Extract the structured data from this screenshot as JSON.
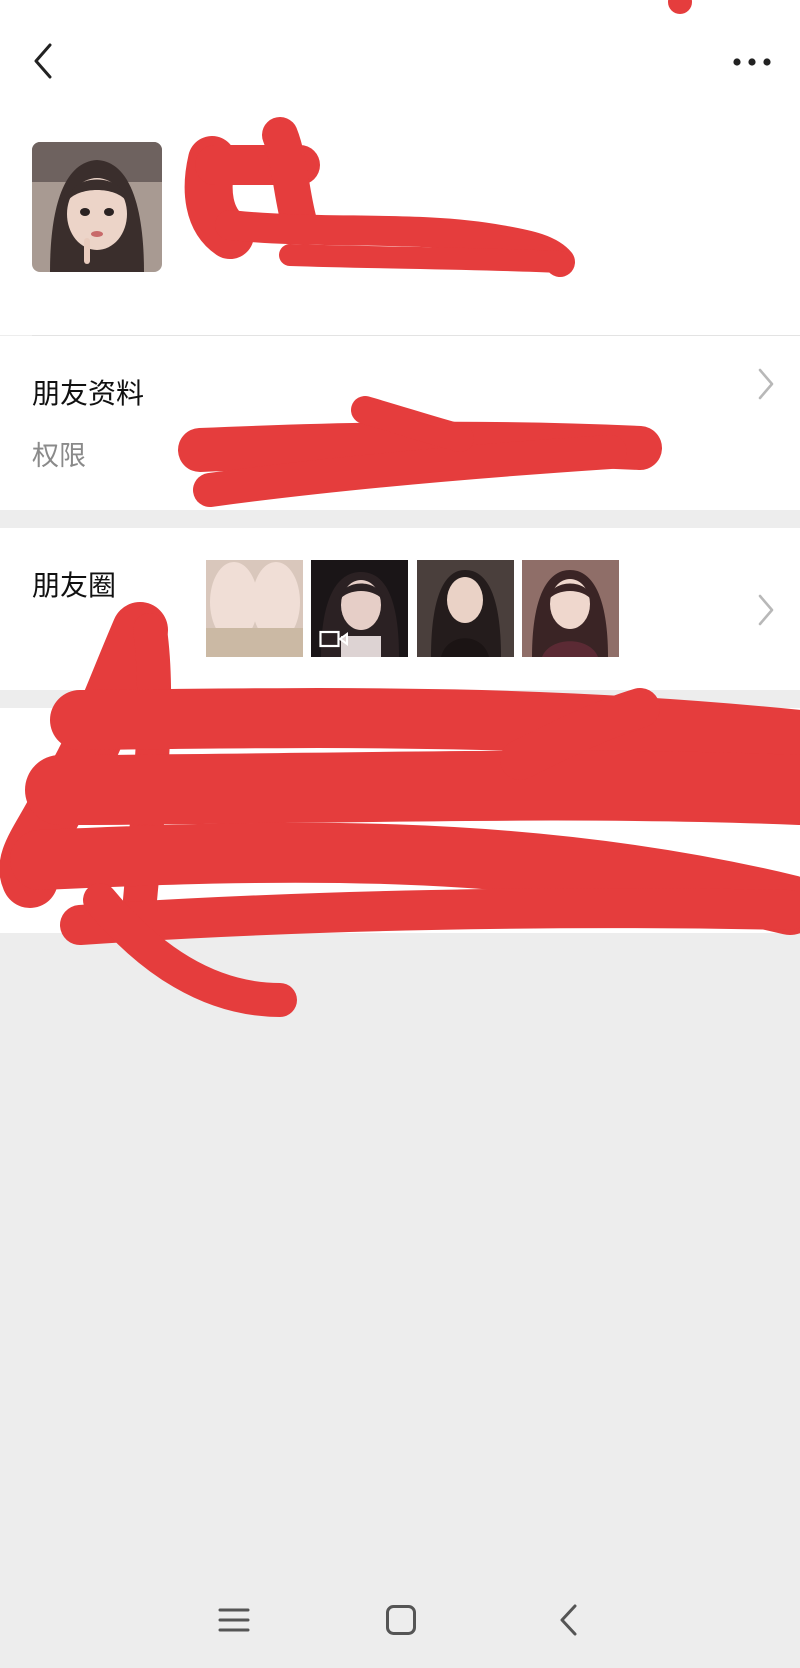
{
  "header": {
    "back_icon": "chevron-left-icon",
    "more_icon": "more-horizontal-icon"
  },
  "profile": {
    "avatar_icon": "avatar-photo",
    "name_redacted": true
  },
  "friend_info": {
    "title": "朋友资料",
    "permissions_label": "权限"
  },
  "moments": {
    "title": "朋友圈",
    "thumbnails": [
      {
        "kind": "photo"
      },
      {
        "kind": "video",
        "badge_icon": "video-icon"
      },
      {
        "kind": "photo"
      },
      {
        "kind": "photo"
      }
    ]
  },
  "system_nav": {
    "menu_icon": "menu-icon",
    "home_icon": "home-square-icon",
    "back_icon": "back-chevron-icon"
  },
  "colors": {
    "page_bg": "#ededed",
    "card_bg": "#ffffff",
    "redaction": "#e53d3d",
    "secondary_text": "#8a8a8a"
  }
}
